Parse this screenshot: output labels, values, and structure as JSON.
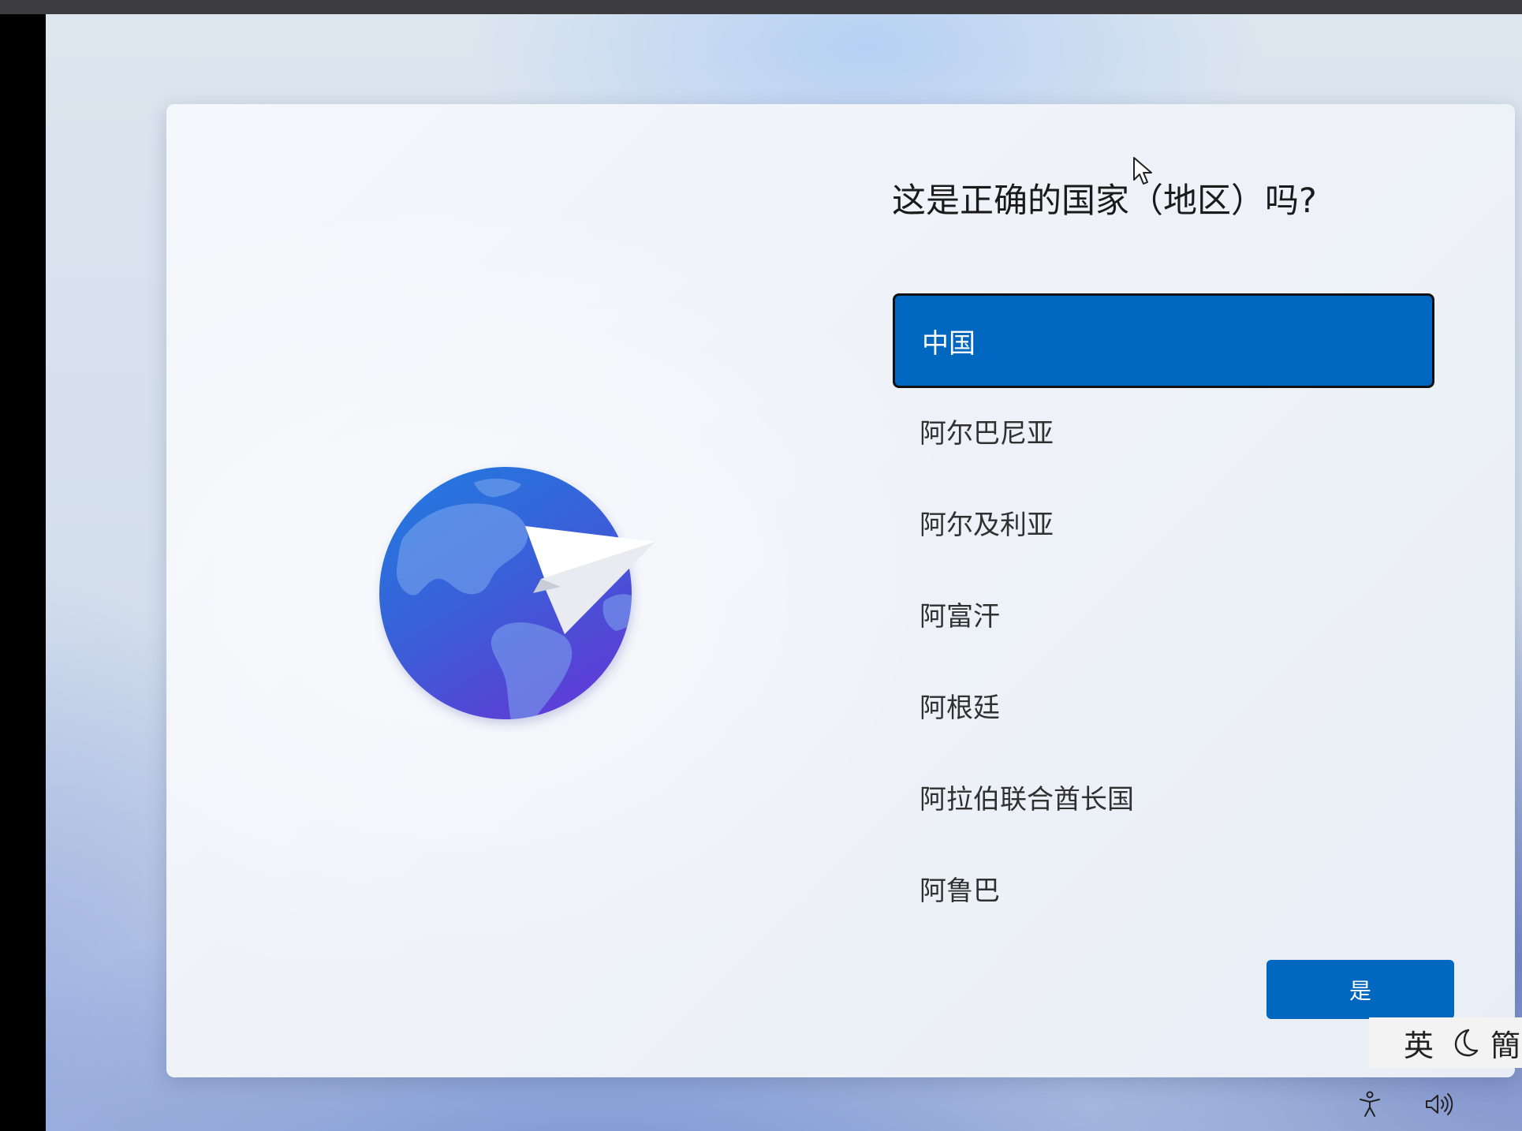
{
  "setup": {
    "title": "这是正确的国家（地区）吗?",
    "countries": [
      {
        "label": "中国",
        "selected": true
      },
      {
        "label": "阿尔巴尼亚",
        "selected": false
      },
      {
        "label": "阿尔及利亚",
        "selected": false
      },
      {
        "label": "阿富汗",
        "selected": false
      },
      {
        "label": "阿根廷",
        "selected": false
      },
      {
        "label": "阿拉伯联合酋长国",
        "selected": false
      },
      {
        "label": "阿鲁巴",
        "selected": false
      }
    ],
    "yes_button_label": "是"
  },
  "ime": {
    "mode_label": "英",
    "script_label": "簡"
  },
  "icons": {
    "illustration": "globe-with-paper-plane-icon",
    "accessibility": "accessibility-icon",
    "volume": "volume-icon",
    "moon": "moon-icon",
    "cursor": "mouse-cursor-icon"
  },
  "colors": {
    "accent": "#0067c0",
    "selected_border": "#111111"
  }
}
